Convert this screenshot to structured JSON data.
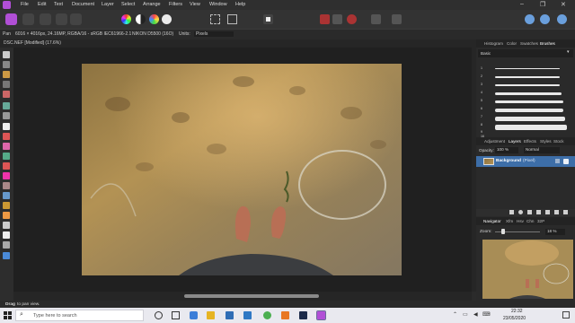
{
  "menubar": {
    "items": [
      "File",
      "Edit",
      "Text",
      "Document",
      "Layer",
      "Select",
      "Arrange",
      "Filters",
      "View",
      "Window",
      "Help"
    ],
    "window_controls": [
      "–",
      "❐",
      "✕"
    ]
  },
  "context_bar": {
    "tool_name": "Pan",
    "image_info": "6016 × 4016px, 24.16MP, RGBA/16 - sRGB IEC61966-2.1",
    "camera": "NIKON D5500 (16O)",
    "units_label": "Units:",
    "units_value": "Pixels"
  },
  "document_tab": {
    "title": "DSC.NEF [Modified] (17.6%)"
  },
  "brushes_panel": {
    "tabs": [
      "Histogram",
      "Color",
      "Swatches",
      "Brushes"
    ],
    "active_tab": "Brushes",
    "category": "Basic",
    "sizes": [
      "1",
      "2",
      "3",
      "4",
      "5",
      "6",
      "7",
      "8",
      "9",
      "16"
    ]
  },
  "layers_panel": {
    "tabs": [
      "Adjustment",
      "Layers",
      "Effects",
      "Styles",
      "Stock"
    ],
    "active_tab": "Layers",
    "opacity_label": "Opacity:",
    "opacity_value": "100 %",
    "blend_mode": "Normal",
    "layers": [
      {
        "name": "Background",
        "type": "(Pixel)"
      }
    ]
  },
  "navigator_panel": {
    "tabs": [
      "Navigator",
      "Xfm",
      "Hsv",
      "Chn",
      "32P"
    ],
    "active_tab": "Navigator",
    "zoom_label": "Zoom:",
    "zoom_value": "18 %"
  },
  "status_bar": {
    "text_bold": "Drag",
    "text_rest": "to pan view."
  },
  "taskbar": {
    "search_placeholder": "Type here to search",
    "time": "22:32",
    "date": "23/05/2020"
  },
  "colors": {
    "accent": "#b14fd6",
    "selection": "#3d6ea8",
    "taskbar": "#e9e9ef"
  }
}
